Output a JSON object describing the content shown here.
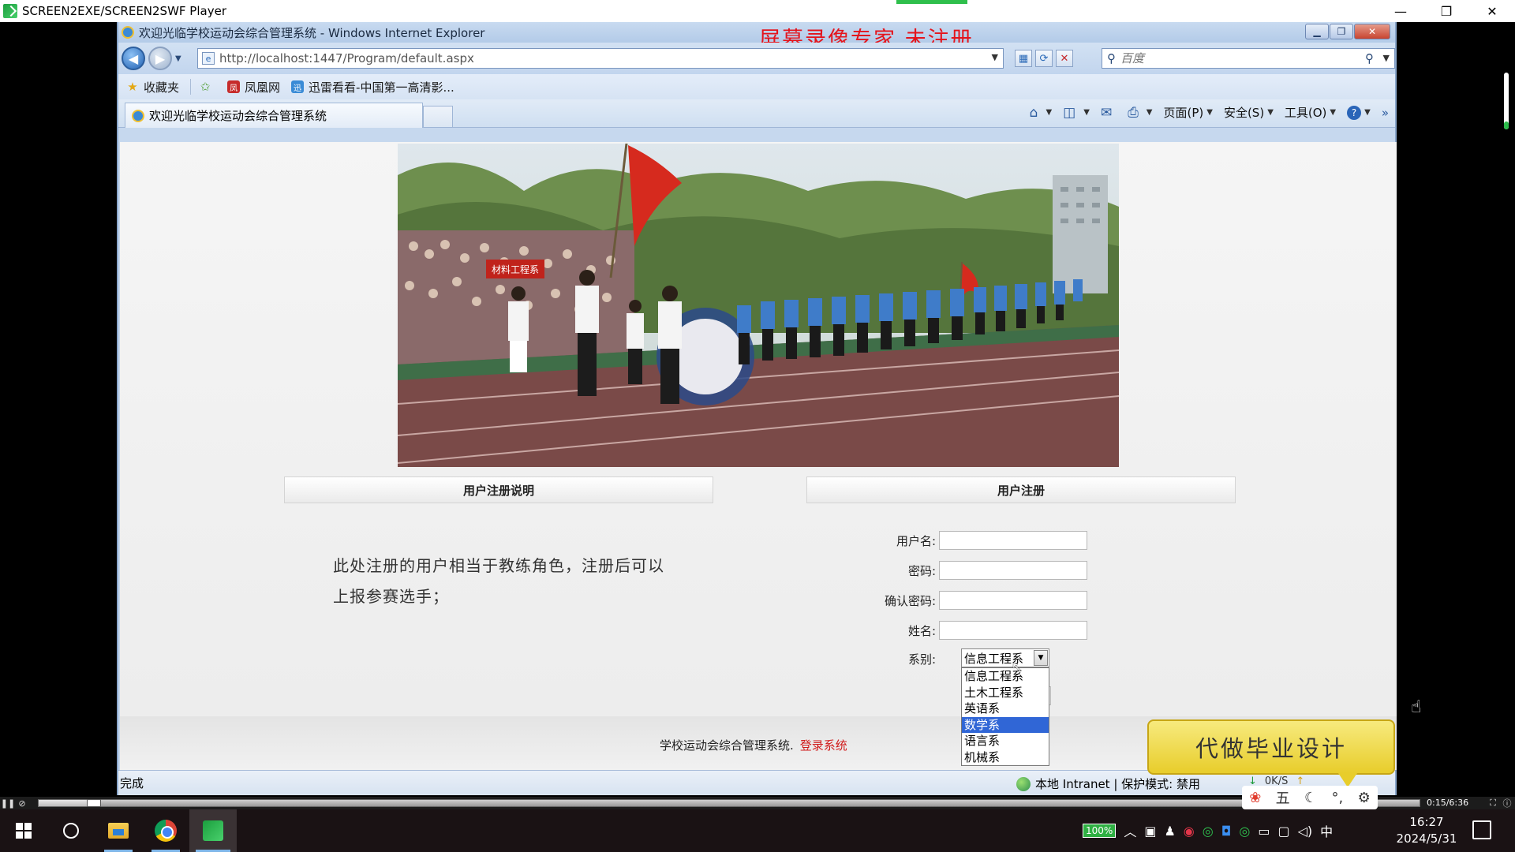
{
  "player": {
    "title": "SCREEN2EXE/SCREEN2SWF Player",
    "time": "0:15/6:36",
    "progress_fraction": 0.04
  },
  "ie": {
    "title": "欢迎光临学校运动会综合管理系统 - Windows Internet Explorer",
    "watermark": "屏幕录像专家  未注册",
    "url": "http://localhost:1447/Program/default.aspx",
    "search_placeholder": "百度",
    "favorites": {
      "label": "收藏夹",
      "items": [
        "凤凰网",
        "迅雷看看-中国第一高清影..."
      ]
    },
    "tab_title": "欢迎光临学校运动会综合管理系统",
    "commands": {
      "page": "页面(P)",
      "safety": "安全(S)",
      "tools": "工具(O)"
    },
    "status": {
      "done": "完成",
      "zone": "本地 Intranet | 保护模式: 禁用",
      "speed": "0K/S"
    }
  },
  "page": {
    "intro_header": "用户注册说明",
    "register_header": "用户注册",
    "intro_text": "此处注册的用户相当于教练角色，注册后可以上报参赛选手；",
    "form": {
      "username_label": "用户名:",
      "password_label": "密码:",
      "confirm_label": "确认密码:",
      "name_label": "姓名:",
      "dept_label": "系别:",
      "dept_selected": "信息工程系",
      "dept_options": [
        "信息工程系",
        "土木工程系",
        "英语系",
        "数学系",
        "语言系",
        "机械系"
      ],
      "dept_highlighted_index": 3
    },
    "footer": {
      "text": "学校运动会综合管理系统.",
      "login_link": "登录系统"
    }
  },
  "overlay": {
    "ad_text": "代做毕业设计",
    "ime_mode": "五"
  },
  "taskbar": {
    "battery": "100%",
    "ime": "中",
    "time": "16:27",
    "date": "2024/5/31"
  }
}
